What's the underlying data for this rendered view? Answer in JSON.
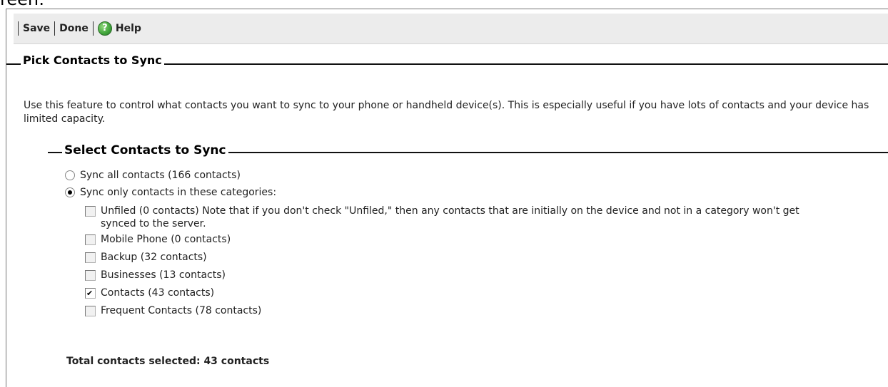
{
  "top_text": "reen:",
  "toolbar": {
    "save_label": "Save",
    "done_label": "Done",
    "help_label": "Help"
  },
  "section": {
    "legend": "Pick Contacts to Sync",
    "description": "Use this feature to control what contacts you want to sync to your phone or handheld device(s). This is especially useful if you have lots of contacts and your device has limited capacity.",
    "subsection": {
      "legend": "Select Contacts to Sync",
      "radio_options": [
        {
          "label": "Sync all contacts (166 contacts)",
          "checked": false
        },
        {
          "label": "Sync only contacts in these categories:",
          "checked": true
        }
      ],
      "categories": [
        {
          "label": "Unfiled (0 contacts) Note that if you don't check \"Unfiled,\" then any contacts that are initially on the device and not in a category won't get synced to the server.",
          "checked": false
        },
        {
          "label": "Mobile Phone (0 contacts)",
          "checked": false
        },
        {
          "label": "Backup (32 contacts)",
          "checked": false
        },
        {
          "label": "Businesses (13 contacts)",
          "checked": false
        },
        {
          "label": "Contacts (43 contacts)",
          "checked": true
        },
        {
          "label": "Frequent Contacts (78 contacts)",
          "checked": false
        }
      ],
      "total_text": "Total contacts selected: 43 contacts"
    }
  },
  "colors": {
    "toolbar_bg": "#ececec",
    "help_icon": "#3fa33a"
  },
  "icons": {
    "help": "help-icon"
  }
}
